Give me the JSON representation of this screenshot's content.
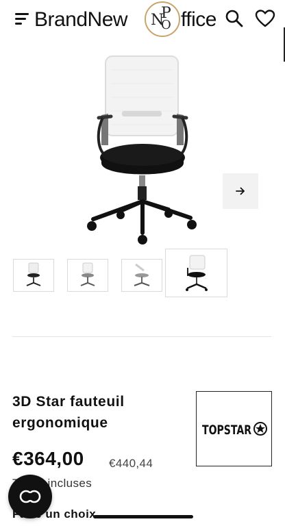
{
  "header": {
    "logo_left": "BrandNew",
    "logo_right": "ffice",
    "logo_mark_n": "N",
    "logo_mark_o": "O",
    "logo_mark_p": "P",
    "icons": [
      "menu-icon",
      "search-icon",
      "heart-icon"
    ]
  },
  "gallery": {
    "next_icon": "arrow-right-icon",
    "thumbnail_count": 4,
    "selected_thumbnail": 4
  },
  "product": {
    "title": "3D Star fauteuil ergonomique",
    "price": "€364,00",
    "price_old": "€440,44",
    "tax_note": "Taxes incluses",
    "choice_label": "Faire un choix",
    "brand_logo_text": "TOPSTAR"
  },
  "colors": {
    "accent_gold": "#c9a46a",
    "text": "#111111",
    "button_bg": "#f2f2f2",
    "chat_bg": "#111111"
  }
}
